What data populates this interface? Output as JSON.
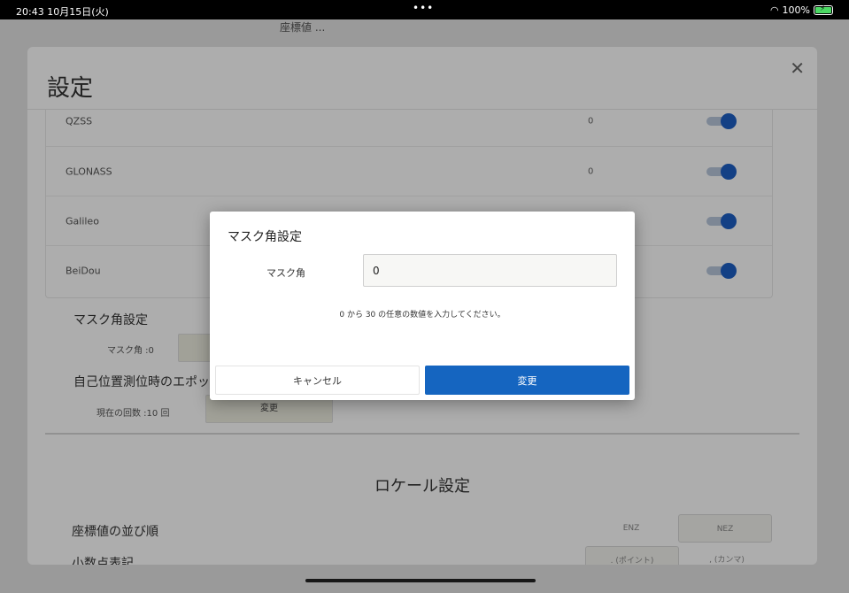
{
  "status_bar": {
    "time": "20:43",
    "date": "10月15日(火)",
    "dots": "•••",
    "battery_percent": "100%",
    "icons": [
      "wifi-icon",
      "battery-charging-icon"
    ]
  },
  "app": {
    "top_text": "座標値 ... ",
    "settings_title": "設定",
    "close_icon": "close-icon",
    "satellites": [
      {
        "name": "QZSS",
        "value": "0",
        "enabled": true
      },
      {
        "name": "GLONASS",
        "value": "0",
        "enabled": true
      },
      {
        "name": "Galileo",
        "value": "",
        "enabled": true
      },
      {
        "name": "BeiDou",
        "value": "",
        "enabled": true
      }
    ],
    "mask_section_title": "マスク角設定",
    "mask_current_label": "マスク角 :0",
    "epoch_section_title": "自己位置測位時のエポッ",
    "epoch_current_label": "現在の回数 :10 回",
    "epoch_change_button": "変更",
    "locale_title": "ロケール設定",
    "coord_order_label": "座標値の並び順",
    "coord_order_options": [
      "ENZ",
      "NEZ"
    ],
    "coord_order_selected": "NEZ",
    "decimal_label": "小数点表記",
    "decimal_options": [
      ". (ポイント)",
      ", (カンマ)"
    ],
    "decimal_selected": ". (ポイント)"
  },
  "dialog": {
    "title": "マスク角設定",
    "field_label": "マスク角",
    "field_value": "0",
    "help_text": "0 から 30 の任意の数値を入力してください。",
    "cancel_label": "キャンセル",
    "confirm_label": "変更"
  },
  "colors": {
    "primary": "#1565c0",
    "toggle_on": "#1d5fc4"
  }
}
